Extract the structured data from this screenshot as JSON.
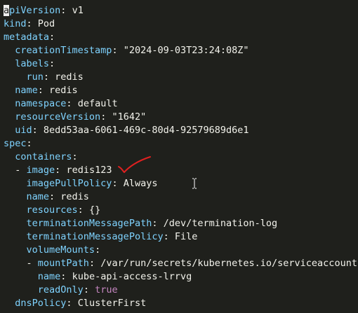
{
  "lines": [
    {
      "cursor": "a",
      "key": "piVersion",
      "value": "v1"
    },
    {
      "key": "kind",
      "value": "Pod"
    },
    {
      "key": "metadata"
    },
    {
      "key": "creationTimestamp",
      "value": "\"2024-09-03T23:24:08Z\""
    },
    {
      "key": "labels"
    },
    {
      "key": "run",
      "value": "redis"
    },
    {
      "key": "name",
      "value": "redis"
    },
    {
      "key": "namespace",
      "value": "default"
    },
    {
      "key": "resourceVersion",
      "value": "\"1642\""
    },
    {
      "key": "uid",
      "value": "8edd53aa-6061-469c-80d4-92579689d6e1"
    },
    {
      "key": "spec"
    },
    {
      "key": "containers"
    },
    {
      "dash": "- ",
      "key": "image",
      "value": "redis123"
    },
    {
      "key": "imagePullPolicy",
      "value": "Always"
    },
    {
      "key": "name",
      "value": "redis"
    },
    {
      "key": "resources",
      "value": "{}"
    },
    {
      "key": "terminationMessagePath",
      "value": "/dev/termination-log"
    },
    {
      "key": "terminationMessagePolicy",
      "value": "File"
    },
    {
      "key": "volumeMounts"
    },
    {
      "dash": "- ",
      "key": "mountPath",
      "value": "/var/run/secrets/kubernetes.io/serviceaccount"
    },
    {
      "key": "name",
      "value": "kube-api-access-lrrvg"
    },
    {
      "key": "readOnly",
      "value": "true"
    },
    {
      "key": "dnsPolicy",
      "value": "ClusterFirst"
    }
  ],
  "annotation_color": "#e02020",
  "icons": {
    "annotation": "red-checkmark-icon",
    "cursor": "text-ibeam-cursor-icon"
  }
}
